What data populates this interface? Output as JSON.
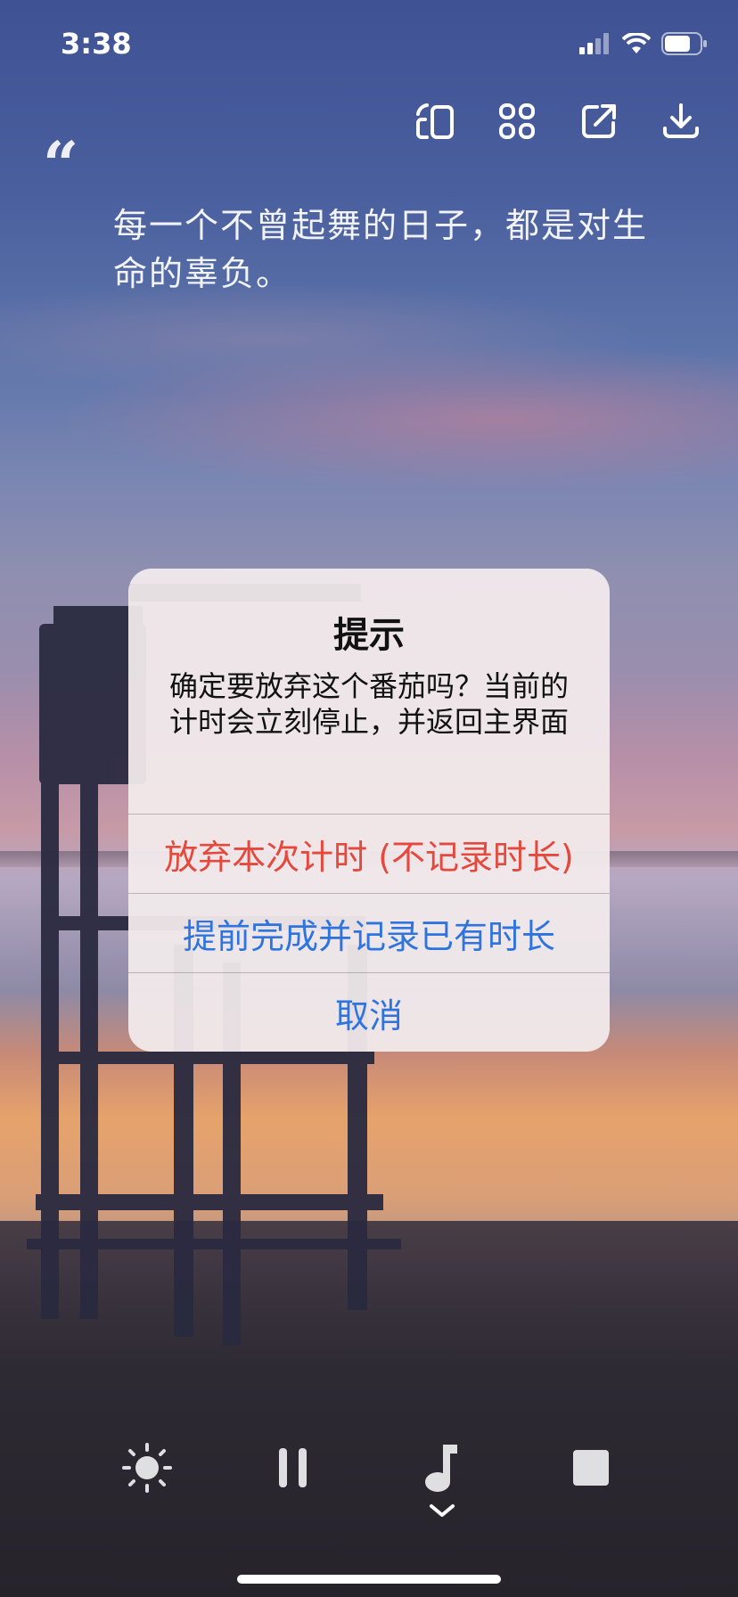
{
  "status_bar": {
    "time": "3:38"
  },
  "toolbar": {
    "items": [
      {
        "icon": "rotate-layout-icon"
      },
      {
        "icon": "apps-grid-icon"
      },
      {
        "icon": "share-icon"
      },
      {
        "icon": "download-icon"
      }
    ]
  },
  "quote": {
    "mark": "“",
    "text": "每一个不曾起舞的日子，都是对生命的辜负。"
  },
  "dialog": {
    "title": "提示",
    "message": "确定要放弃这个番茄吗？当前的计时会立刻停止，并返回主界面",
    "buttons": {
      "abandon": "放弃本次计时 (不记录时长)",
      "finish_early": "提前完成并记录已有时长",
      "cancel": "取消"
    },
    "colors": {
      "destructive": "#e5483c",
      "action": "#2e74e0"
    }
  },
  "controls": {
    "items": [
      {
        "icon": "brightness-icon"
      },
      {
        "icon": "pause-icon"
      },
      {
        "icon": "music-note-icon"
      },
      {
        "icon": "stop-icon"
      }
    ]
  }
}
